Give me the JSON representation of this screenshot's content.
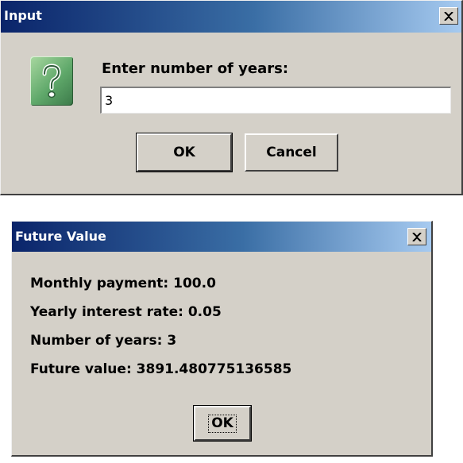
{
  "input_dialog": {
    "title": "Input",
    "close_symbol": "close-icon",
    "icon": "question-icon",
    "prompt": "Enter number of years:",
    "input_value": "3",
    "ok_label": "OK",
    "cancel_label": "Cancel"
  },
  "result_dialog": {
    "title": "Future Value",
    "close_symbol": "close-icon",
    "lines": [
      "Monthly payment: 100.0",
      "Yearly interest rate: 0.05",
      "Number of years: 3",
      "Future value: 3891.480775136585"
    ],
    "ok_label": "OK"
  },
  "colors": {
    "dialog_bg": "#d4d0c8",
    "titlebar_start": "#0a246a",
    "titlebar_end": "#a6caf0",
    "icon_green": "#5fa86a"
  }
}
